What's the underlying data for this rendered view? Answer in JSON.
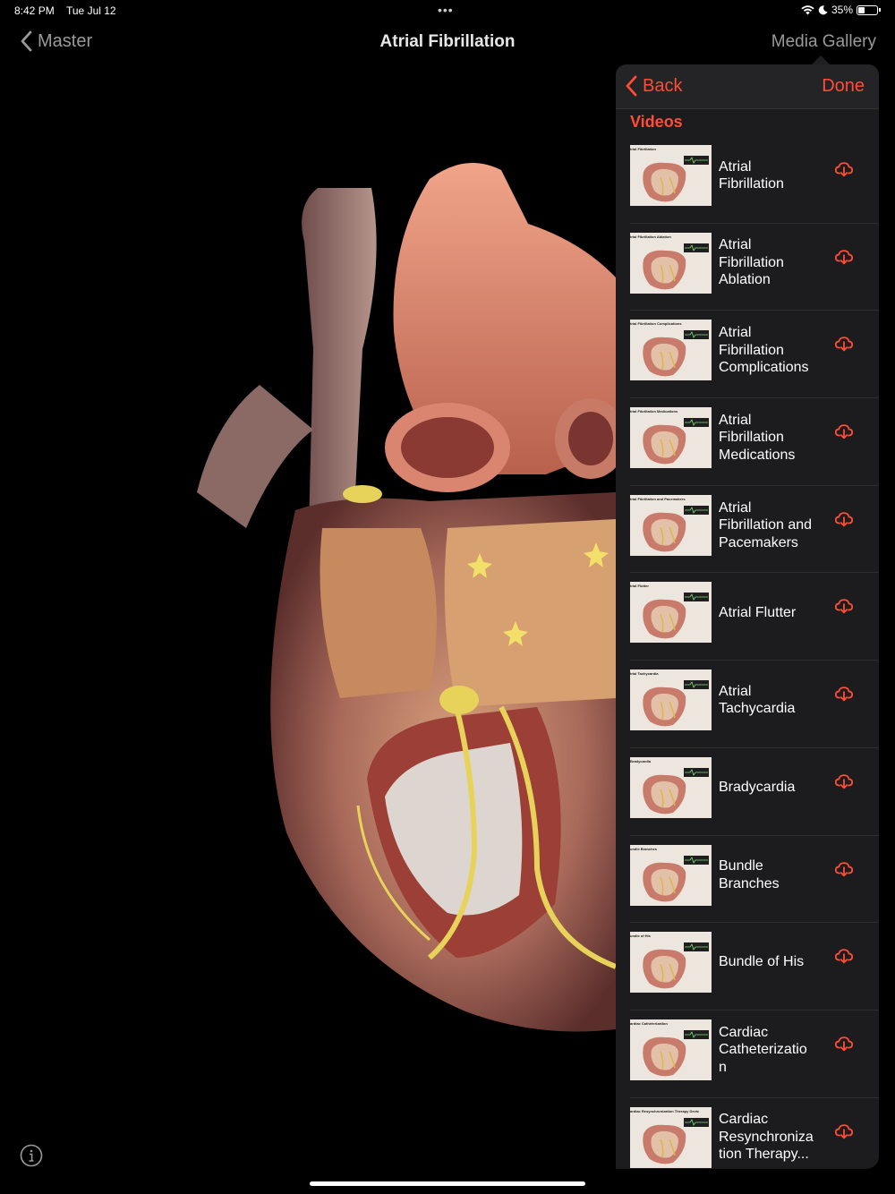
{
  "status_bar": {
    "time": "8:42 PM",
    "date": "Tue Jul 12",
    "dots": "•••",
    "battery": "35%",
    "battery_level": 0.35
  },
  "nav": {
    "back_label": "Master",
    "title": "Atrial Fibrillation",
    "gallery_label": "Media Gallery"
  },
  "popover": {
    "back_label": "Back",
    "done_label": "Done",
    "section_title": "Videos",
    "videos": [
      {
        "label": "Atrial Fibrillation",
        "thumb_caption": "trial Fibrillation"
      },
      {
        "label": "Atrial Fibrillation Ablation",
        "thumb_caption": "trial Fibrillation Ablation"
      },
      {
        "label": "Atrial Fibrillation Complications",
        "thumb_caption": "trial Fibrillation Complications"
      },
      {
        "label": "Atrial Fibrillation Medications",
        "thumb_caption": "trial Fibrillation Medications"
      },
      {
        "label": "Atrial Fibrillation and Pacemakers",
        "thumb_caption": "trial Fibrillation and Pacemakers"
      },
      {
        "label": "Atrial Flutter",
        "thumb_caption": "trial Flutter"
      },
      {
        "label": "Atrial Tachycardia",
        "thumb_caption": "trial Tachycardia"
      },
      {
        "label": "Bradycardia",
        "thumb_caption": "Bradycardia"
      },
      {
        "label": "Bundle Branches",
        "thumb_caption": "undle Branches"
      },
      {
        "label": "Bundle of His",
        "thumb_caption": "undle of His"
      },
      {
        "label": "Cardiac Catheterizatio n",
        "thumb_caption": "ardiac Catheterization"
      },
      {
        "label": "Cardiac Resynchroniza tion Therapy...",
        "thumb_caption": "ardiac Resynchronization Therapy Devic"
      }
    ]
  },
  "icons": {
    "download": "cloud-download-icon",
    "info": "info-icon",
    "back": "chevron-left-icon"
  },
  "colors": {
    "accent": "#ff4d36",
    "background": "#000000",
    "popover": "#1c1c1e"
  }
}
